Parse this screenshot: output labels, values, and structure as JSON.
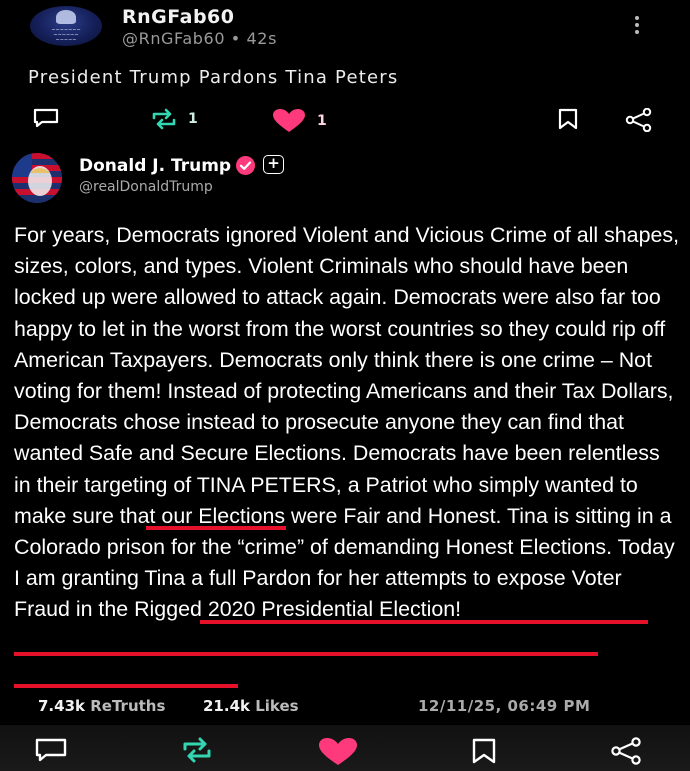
{
  "outer_post": {
    "display_name": "RnGFab60",
    "handle_time": "@RnGFab60 • 42s",
    "title": "President Trump Pardons Tina Peters",
    "retruth_count": "1",
    "like_count": "1"
  },
  "inner_post": {
    "display_name": "Donald J. Trump",
    "handle": "@realDonaldTrump",
    "plus_label": "+",
    "body_part1": "For years, Democrats ignored Violent and Vicious Crime of all shapes, sizes, colors, and types. Violent Criminals who should have been locked up were allowed to attack again. Democrats were also far too happy to let in the worst from the worst countries so they could rip off American Taxpayers. Democrats only think there is one crime – Not voting for them! Instead of protecting Americans and their Tax Dollars, Democrats chose instead to prosecute anyone they can find that wanted Safe and Secure Elections. Democrats have been relentless in their targeting of ",
    "body_highlight1": "TINA PETERS,",
    "body_part2": " a Patriot who simply wanted to make sure that our Elections were Fair and Honest. Tina is sitting in a Colorado prison for the “crime” of demanding Honest Elections. ",
    "body_highlight2": "Today I am granting Tina a full Pardon for her attempts to expose Voter Fraud in the Rigged 2020 Presidential Election!",
    "retruths_num": "7.43k",
    "retruths_label": "ReTruths",
    "likes_num": "21.4k",
    "likes_label": "Likes",
    "timestamp": "12/11/25, 06:49 PM"
  },
  "colors": {
    "background": "#000000",
    "accent_pink": "#ff3a7c",
    "accent_teal": "#33d6b0",
    "underline_red": "#e5112b"
  },
  "icons": [
    "reply-icon",
    "retruth-icon",
    "heart-icon",
    "bookmark-icon",
    "share-icon",
    "more-vertical-icon",
    "verified-badge-icon"
  ]
}
